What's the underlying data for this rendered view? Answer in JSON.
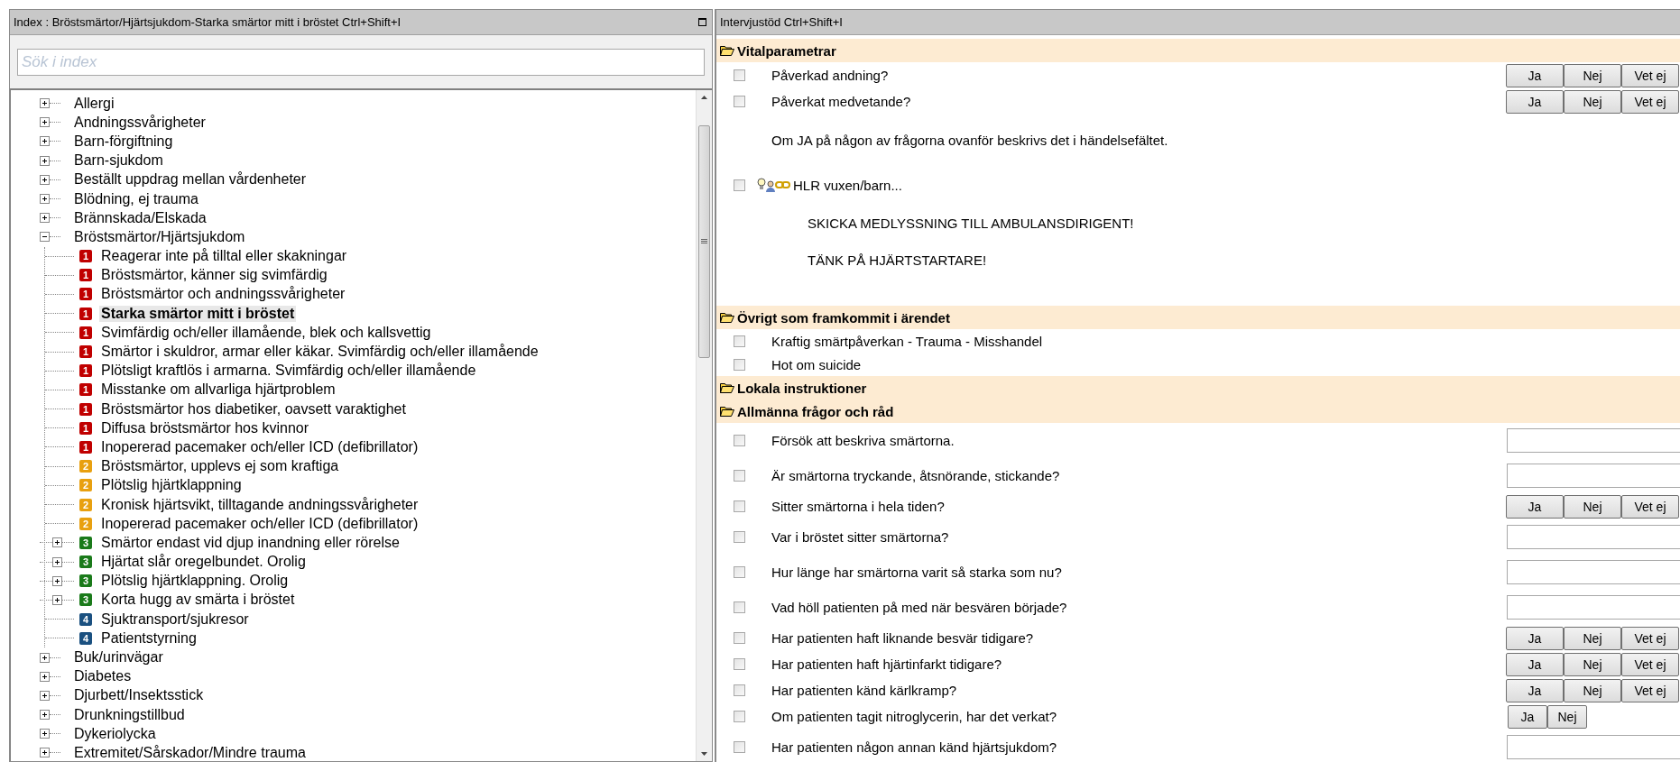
{
  "index_panel": {
    "title": "Index : Bröstsmärtor/Hjärtsjukdom-Starka smärtor mitt i bröstet Ctrl+Shift+I",
    "search": {
      "placeholder": "Sök i index"
    },
    "tree": [
      {
        "label": "Allergi",
        "expanded": false,
        "selected": false
      },
      {
        "label": "Andningssvårigheter",
        "expanded": false,
        "selected": false
      },
      {
        "label": "Barn-förgiftning",
        "expanded": false,
        "selected": false
      },
      {
        "label": "Barn-sjukdom",
        "expanded": false,
        "selected": false
      },
      {
        "label": "Beställt uppdrag mellan vårdenheter",
        "expanded": false,
        "selected": false
      },
      {
        "label": "Blödning, ej trauma",
        "expanded": false,
        "selected": false
      },
      {
        "label": "Brännskada/Elskada",
        "expanded": false,
        "selected": false
      },
      {
        "label": "Bröstsmärtor/Hjärtsjukdom",
        "expanded": true,
        "selected": false,
        "children": [
          {
            "badge": "1",
            "color": "#c00000",
            "label": "Reagerar inte på tilltal eller skakningar",
            "selected": false
          },
          {
            "badge": "1",
            "color": "#c00000",
            "label": "Bröstsmärtor, känner sig svimfärdig",
            "selected": false
          },
          {
            "badge": "1",
            "color": "#c00000",
            "label": "Bröstsmärtor och andningssvårigheter",
            "selected": false
          },
          {
            "badge": "1",
            "color": "#c00000",
            "label": "Starka smärtor mitt i bröstet",
            "selected": true
          },
          {
            "badge": "1",
            "color": "#c00000",
            "label": "Svimfärdig och/eller illamående, blek och kallsvettig",
            "selected": false
          },
          {
            "badge": "1",
            "color": "#c00000",
            "label": "Smärtor i skuldror, armar eller käkar. Svimfärdig och/eller illamående",
            "selected": false
          },
          {
            "badge": "1",
            "color": "#c00000",
            "label": "Plötsligt kraftlös i armarna. Svimfärdig och/eller illamående",
            "selected": false
          },
          {
            "badge": "1",
            "color": "#c00000",
            "label": "Misstanke om allvarliga hjärtproblem",
            "selected": false
          },
          {
            "badge": "1",
            "color": "#c00000",
            "label": "Bröstsmärtor hos diabetiker, oavsett varaktighet",
            "selected": false
          },
          {
            "badge": "1",
            "color": "#c00000",
            "label": "Diffusa bröstsmärtor hos kvinnor",
            "selected": false
          },
          {
            "badge": "1",
            "color": "#c00000",
            "label": "Inopererad pacemaker och/eller ICD (defibrillator)",
            "selected": false
          },
          {
            "badge": "2",
            "color": "#e8a010",
            "label": "Bröstsmärtor, upplevs ej som kraftiga",
            "selected": false
          },
          {
            "badge": "2",
            "color": "#e8a010",
            "label": "Plötslig hjärtklappning",
            "selected": false
          },
          {
            "badge": "2",
            "color": "#e8a010",
            "label": "Kronisk hjärtsvikt, tilltagande andningssvårigheter",
            "selected": false
          },
          {
            "badge": "2",
            "color": "#e8a010",
            "label": "Inopererad pacemaker och/eller ICD (defibrillator)",
            "selected": false
          },
          {
            "badge": "3",
            "color": "#1a7a1a",
            "label": "Smärtor endast vid djup inandning eller rörelse",
            "selected": false,
            "expanded": false
          },
          {
            "badge": "3",
            "color": "#1a7a1a",
            "label": "Hjärtat slår oregelbundet. Orolig",
            "selected": false,
            "expanded": false
          },
          {
            "badge": "3",
            "color": "#1a7a1a",
            "label": "Plötslig hjärtklappning. Orolig",
            "selected": false,
            "expanded": false
          },
          {
            "badge": "3",
            "color": "#1a7a1a",
            "label": "Korta hugg av smärta i bröstet",
            "selected": false,
            "expanded": false
          },
          {
            "badge": "4",
            "color": "#1a5080",
            "label": "Sjuktransport/sjukresor",
            "selected": false
          },
          {
            "badge": "4",
            "color": "#1a5080",
            "label": "Patientstyrning",
            "selected": false
          }
        ]
      },
      {
        "label": "Buk/urinvägar",
        "expanded": false,
        "selected": false
      },
      {
        "label": "Diabetes",
        "expanded": false,
        "selected": false
      },
      {
        "label": "Djurbett/Insektsstick",
        "expanded": false,
        "selected": false
      },
      {
        "label": "Drunkningstillbud",
        "expanded": false,
        "selected": false
      },
      {
        "label": "Dykeriolycka",
        "expanded": false,
        "selected": false
      },
      {
        "label": "Extremitet/Sårskador/Mindre trauma",
        "expanded": false,
        "selected": false
      }
    ]
  },
  "interview_panel": {
    "title": "Intervjustöd Ctrl+Shift+I",
    "sections": [
      {
        "title": "Vitalparametrar",
        "rows": [
          {
            "kind": "yesno",
            "text": "Påverkad andning?",
            "checked": false,
            "buttons": [
              "Ja",
              "Nej",
              "Vet ej"
            ]
          },
          {
            "kind": "yesno",
            "text": "Påverkat medvetande?",
            "checked": false,
            "buttons": [
              "Ja",
              "Nej",
              "Vet ej"
            ]
          },
          {
            "kind": "note",
            "text": "Om JA på någon av frågorna ovanför beskrivs det i händelsefältet."
          },
          {
            "kind": "link",
            "text": "HLR vuxen/barn...",
            "checked": false
          },
          {
            "kind": "alert",
            "text": "SKICKA MEDLYSSNING TILL AMBULANSDIRIGENT!"
          },
          {
            "kind": "alert",
            "text": "TÄNK PÅ HJÄRTSTARTARE!"
          }
        ]
      },
      {
        "title": "Övrigt som framkommit i ärendet",
        "rows": [
          {
            "kind": "check",
            "text": "Kraftig smärtpåverkan - Trauma - Misshandel",
            "checked": false
          },
          {
            "kind": "check",
            "text": "Hot om suicide",
            "checked": false
          }
        ]
      },
      {
        "title": "Lokala instruktioner"
      },
      {
        "title": "Allmänna frågor och råd",
        "rows": [
          {
            "kind": "text",
            "text": "Försök att beskriva smärtorna.",
            "checked": false
          },
          {
            "kind": "text",
            "text": "Är smärtorna tryckande, åtsnörande, stickande?",
            "checked": false
          },
          {
            "kind": "yesno",
            "text": "Sitter smärtorna i hela tiden?",
            "checked": false,
            "buttons": [
              "Ja",
              "Nej",
              "Vet ej"
            ]
          },
          {
            "kind": "text",
            "text": "Var i bröstet sitter smärtorna?",
            "checked": false
          },
          {
            "kind": "text",
            "text": "Hur länge har smärtorna varit så starka som nu?",
            "checked": false
          },
          {
            "kind": "text",
            "text": "Vad höll patienten på med när besvären började?",
            "checked": false
          },
          {
            "kind": "yesno",
            "text": "Har patienten haft liknande besvär tidigare?",
            "checked": false,
            "buttons": [
              "Ja",
              "Nej",
              "Vet ej"
            ]
          },
          {
            "kind": "yesno",
            "text": "Har patienten haft hjärtinfarkt tidigare?",
            "checked": false,
            "buttons": [
              "Ja",
              "Nej",
              "Vet ej"
            ]
          },
          {
            "kind": "yesno",
            "text": "Har patienten känd kärlkramp?",
            "checked": false,
            "buttons": [
              "Ja",
              "Nej",
              "Vet ej"
            ]
          },
          {
            "kind": "yesno",
            "text": "Om patienten tagit nitroglycerin, har det verkat?",
            "checked": false,
            "buttons": [
              "Ja",
              "Nej"
            ]
          },
          {
            "kind": "text",
            "text": "Har patienten någon annan känd hjärtsjukdom?",
            "checked": false
          }
        ]
      }
    ]
  }
}
